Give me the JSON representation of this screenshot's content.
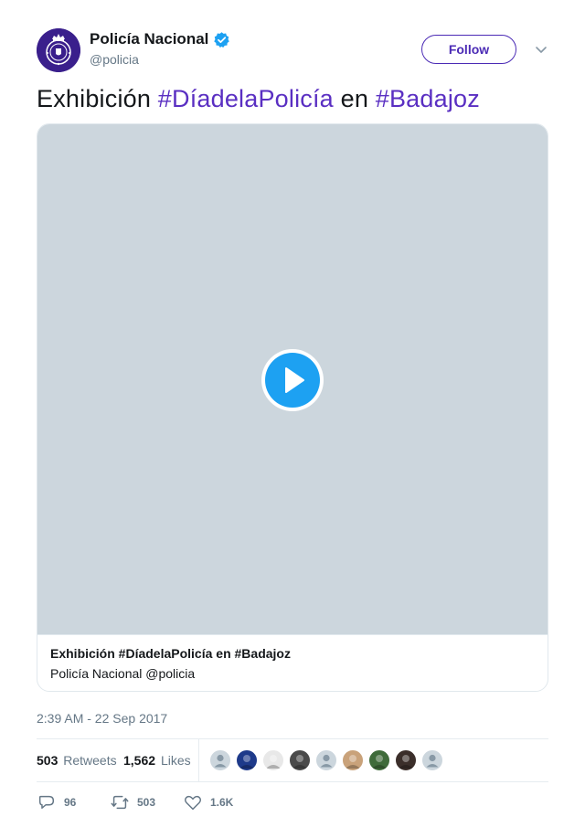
{
  "author": {
    "display_name": "Policía Nacional",
    "handle": "@policia",
    "verified": true,
    "avatar_icon": "police-badge-icon"
  },
  "follow_button": {
    "label": "Follow"
  },
  "menu": {
    "icon": "chevron-down-icon"
  },
  "tweet": {
    "segments": [
      {
        "text": "Exhibición ",
        "type": "text"
      },
      {
        "text": "#DíadelaPolicía",
        "type": "hashtag"
      },
      {
        "text": " en ",
        "type": "text"
      },
      {
        "text": "#Badajoz",
        "type": "hashtag"
      }
    ]
  },
  "media_card": {
    "play_icon": "play-icon",
    "title": "Exhibición #DíadelaPolicía en #Badajoz",
    "subtitle": "Policía Nacional @policia"
  },
  "timestamp": "2:39 AM - 22 Sep 2017",
  "stats": {
    "retweets_count": "503",
    "retweets_label": "Retweets",
    "likes_count": "1,562",
    "likes_label": "Likes"
  },
  "liker_avatars": [
    {
      "name": "default-avatar",
      "color": "#ccd6dd"
    },
    {
      "name": "user-avatar",
      "color": "#1e3a8a"
    },
    {
      "name": "user-avatar",
      "color": "#e8e8e8"
    },
    {
      "name": "user-avatar",
      "color": "#4a4a4a"
    },
    {
      "name": "default-avatar",
      "color": "#ccd6dd"
    },
    {
      "name": "user-avatar",
      "color": "#c9a27a"
    },
    {
      "name": "user-avatar",
      "color": "#3f6b3a"
    },
    {
      "name": "user-avatar",
      "color": "#3b2e2a"
    },
    {
      "name": "default-avatar",
      "color": "#ccd6dd"
    }
  ],
  "actions": {
    "reply_count": "96",
    "retweet_count": "503",
    "like_count": "1.6K"
  },
  "colors": {
    "brand": "#4b2bb5",
    "hashtag": "#5a2fc2",
    "verified": "#1da1f2",
    "play": "#1da1f2",
    "muted": "#657786",
    "media_bg": "#ccd6dd"
  }
}
